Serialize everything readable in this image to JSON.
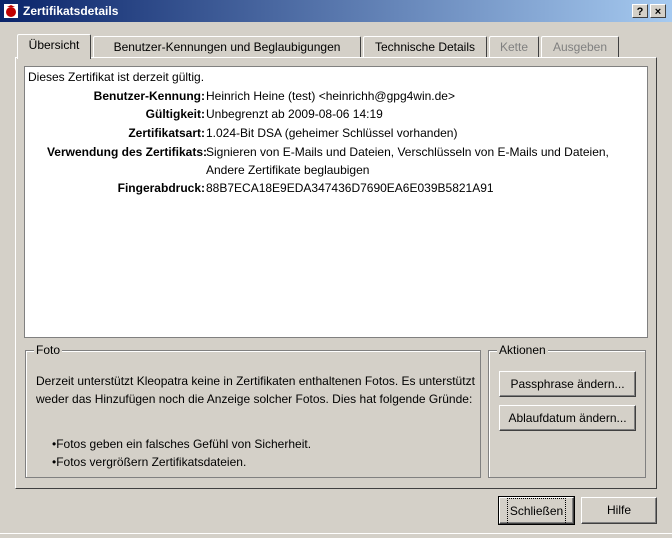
{
  "window": {
    "title": "Zertifikatsdetails",
    "help_glyph": "?",
    "close_glyph": "×",
    "icon": "certificate-app-icon"
  },
  "tabs": [
    {
      "label": "Übersicht",
      "state": "active"
    },
    {
      "label": "Benutzer-Kennungen und Beglaubigungen",
      "state": "normal"
    },
    {
      "label": "Technische Details",
      "state": "normal"
    },
    {
      "label": "Kette",
      "state": "disabled"
    },
    {
      "label": "Ausgeben",
      "state": "disabled"
    }
  ],
  "overview": {
    "status": "Dieses Zertifikat ist derzeit gültig.",
    "fields": [
      {
        "label": "Benutzer-Kennung:",
        "value": "Heinrich Heine (test) <heinrichh@gpg4win.de>"
      },
      {
        "label": "Gültigkeit:",
        "value": "Unbegrenzt ab 2009-08-06 14:19"
      },
      {
        "label": "Zertifikatsart:",
        "value": "1.024-Bit DSA (geheimer Schlüssel vorhanden)"
      },
      {
        "label": "Verwendung des Zertifikats:",
        "value": "Signieren von E-Mails und Dateien, Verschlüsseln von E-Mails und Dateien,",
        "value2": "Andere Zertifikate beglaubigen"
      },
      {
        "label": "Fingerabdruck:",
        "value": "88B7ECA18E9EDA347436D7690EA6E039B5821A91"
      }
    ]
  },
  "photo": {
    "legend": "Foto",
    "text": "Derzeit unterstützt Kleopatra keine in Zertifikaten enthaltenen Fotos. Es unterstützt weder das Hinzufügen noch die Anzeige solcher Fotos. Dies hat folgende Gründe:",
    "reasons": [
      "Fotos geben ein falsches Gefühl von Sicherheit.",
      "Fotos vergrößern Zertifikatsdateien."
    ]
  },
  "actions": {
    "legend": "Aktionen",
    "change_passphrase": "Passphrase ändern...",
    "change_expiry": "Ablaufdatum ändern..."
  },
  "footer": {
    "close": "Schließen",
    "help": "Hilfe"
  },
  "colors": {
    "title_start": "#0a246a",
    "title_end": "#a6caf0",
    "face": "#d4d0c8"
  }
}
